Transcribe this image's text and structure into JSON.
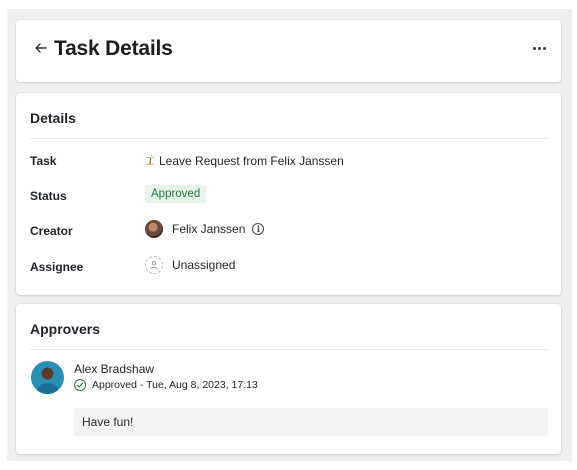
{
  "header": {
    "title": "Task Details"
  },
  "details": {
    "section_title": "Details",
    "rows": [
      {
        "label": "Task",
        "value": "Leave Request from Felix Janssen"
      },
      {
        "label": "Status",
        "value": "Approved"
      },
      {
        "label": "Creator",
        "value": "Felix Janssen"
      },
      {
        "label": "Assignee",
        "value": "Unassigned"
      }
    ],
    "status_color": "#1f7a3d",
    "status_bg": "#e6f4ea"
  },
  "approvers": {
    "section_title": "Approvers",
    "items": [
      {
        "name": "Alex Bradshaw",
        "status": "Approved - Tue, Aug 8, 2023, 17:13",
        "comment": "Have fun!"
      }
    ]
  },
  "icons": {
    "back": "arrow-left-icon",
    "more": "more-horizontal-icon",
    "task": "palm-tree-icon",
    "info": "info-icon",
    "unassigned": "user-placeholder-icon",
    "approved": "check-circle-icon"
  }
}
